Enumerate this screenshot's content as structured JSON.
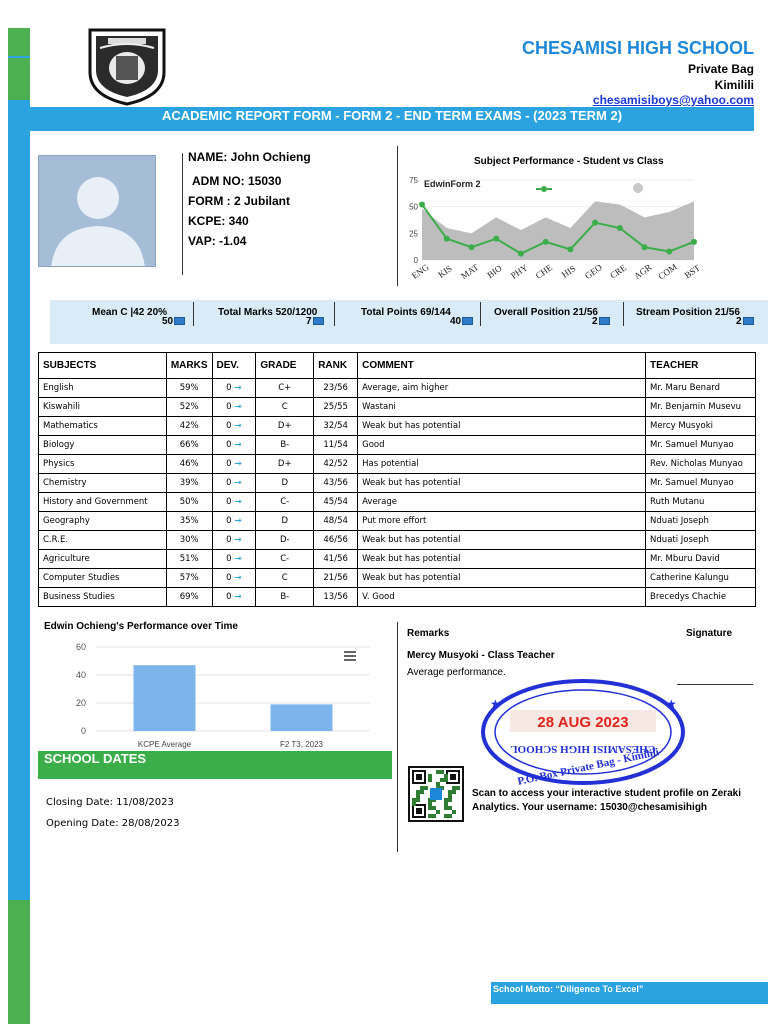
{
  "school": {
    "name": "CHESAMISI HIGH SCHOOL",
    "address1": "Private Bag",
    "address2": "Kimilili",
    "email": "chesamisiboys@yahoo.com"
  },
  "report_title": "ACADEMIC REPORT FORM - FORM 2 - END TERM EXAMS - (2023 TERM 2)",
  "student": {
    "name": "NAME: John Ochieng",
    "adm": "ADM NO: 15030",
    "form": "FORM : 2 Jubilant",
    "kcpe": "KCPE: 340",
    "vap": "VAP: -1.04"
  },
  "summary": [
    {
      "label": "Mean C |42 20%",
      "value": "50"
    },
    {
      "label": "Total Marks 520/1200",
      "value": "7"
    },
    {
      "label": "Total Points 69/144",
      "value": "40"
    },
    {
      "label": "Overall Position 21/56",
      "value": "2"
    },
    {
      "label": "Stream Position 21/56",
      "value": "2"
    }
  ],
  "table": {
    "headers": [
      "SUBJECTS",
      "MARKS",
      "DEV.",
      "GRADE",
      "RANK",
      "COMMENT",
      "TEACHER"
    ],
    "rows": [
      {
        "subject": "English",
        "marks": "59%",
        "dev": "0",
        "grade": "C+",
        "rank": "23/56",
        "comment": "Average, aim higher",
        "teacher": "Mr. Maru Benard"
      },
      {
        "subject": "Kiswahili",
        "marks": "52%",
        "dev": "0",
        "grade": "C",
        "rank": "25/55",
        "comment": "Wastani",
        "teacher": "Mr. Benjamin Musevu"
      },
      {
        "subject": "Mathematics",
        "marks": "42%",
        "dev": "0",
        "grade": "D+",
        "rank": "32/54",
        "comment": "Weak but has potential",
        "teacher": "Mercy Musyoki"
      },
      {
        "subject": "Biology",
        "marks": "66%",
        "dev": "0",
        "grade": "B-",
        "rank": "11/54",
        "comment": "Good",
        "teacher": "Mr. Samuel Munyao"
      },
      {
        "subject": "Physics",
        "marks": "46%",
        "dev": "0",
        "grade": "D+",
        "rank": "42/52",
        "comment": "Has potential",
        "teacher": "Rev. Nicholas Munyao"
      },
      {
        "subject": "Chemistry",
        "marks": "39%",
        "dev": "0",
        "grade": "D",
        "rank": "43/56",
        "comment": "Weak but has potential",
        "teacher": "Mr. Samuel Munyao"
      },
      {
        "subject": "History and Government",
        "marks": "50%",
        "dev": "0",
        "grade": "C-",
        "rank": "45/54",
        "comment": "Average",
        "teacher": "Ruth Mutanu"
      },
      {
        "subject": "Geography",
        "marks": "35%",
        "dev": "0",
        "grade": "D",
        "rank": "48/54",
        "comment": "Put more effort",
        "teacher": "Nduati Joseph"
      },
      {
        "subject": "C.R.E.",
        "marks": "30%",
        "dev": "0",
        "grade": "D-",
        "rank": "46/56",
        "comment": "Weak but has potential",
        "teacher": "Nduati Joseph"
      },
      {
        "subject": "Agriculture",
        "marks": "51%",
        "dev": "0",
        "grade": "C-",
        "rank": "41/56",
        "comment": "Weak but has potential",
        "teacher": "Mr. Mburu David"
      },
      {
        "subject": "Computer Studies",
        "marks": "57%",
        "dev": "0",
        "grade": "C",
        "rank": "21/56",
        "comment": "Weak but has potential",
        "teacher": "Catherine Kalungu"
      },
      {
        "subject": "Business Studies",
        "marks": "69%",
        "dev": "0",
        "grade": "B-",
        "rank": "13/56",
        "comment": "V. Good",
        "teacher": "Brecedys  Chachie"
      }
    ]
  },
  "chart_data": [
    {
      "type": "area",
      "title": "Subject  Performance  -  Student  vs  Class",
      "categories": [
        "ENG",
        "KIS",
        "MAT",
        "BIO",
        "PHY",
        "CHE",
        "HIS",
        "GEO",
        "CRE",
        "AGR",
        "COM",
        "BST"
      ],
      "ylim": [
        0,
        75
      ],
      "yticks": [
        0,
        25,
        50,
        75
      ],
      "series": [
        {
          "name": "EdwinForm  2",
          "type": "line",
          "color": "#3bae4a",
          "values": [
            52,
            20,
            12,
            20,
            6,
            17,
            10,
            35,
            30,
            12,
            8,
            17
          ]
        },
        {
          "name": "",
          "type": "area",
          "color": "#bdbdbd",
          "values": [
            48,
            30,
            25,
            40,
            28,
            40,
            30,
            55,
            52,
            40,
            45,
            55
          ]
        }
      ]
    },
    {
      "type": "bar",
      "title": "Edwin Ochieng's Performance over Time",
      "categories": [
        "KCPE  Average",
        "F2 T3, 2023"
      ],
      "values": [
        47,
        19
      ],
      "ylim": [
        0,
        60
      ],
      "yticks": [
        0,
        20,
        40,
        60
      ],
      "color": "#7cb5ec"
    }
  ],
  "dates": {
    "title": "SCHOOL DATES",
    "closing": "Closing Date: 11/08/2023",
    "opening": "Opening Date: 28/08/2023"
  },
  "remarks": {
    "label": "Remarks",
    "signature_label": "Signature",
    "teacher": "Mercy  Musyoki  -  Class  Teacher",
    "comment": "Average performance."
  },
  "stamp": {
    "date": "28 AUG 2023",
    "text1": "CHESAMISI HIGH SCHOOL",
    "text2": "P.O. Box Private Bag - Kimilili"
  },
  "qr_text": "Scan to access your interactive student profile on Zeraki Analytics. Your username: 15030@chesamisihigh",
  "motto": "School Motto: “Diligence To Excel”"
}
